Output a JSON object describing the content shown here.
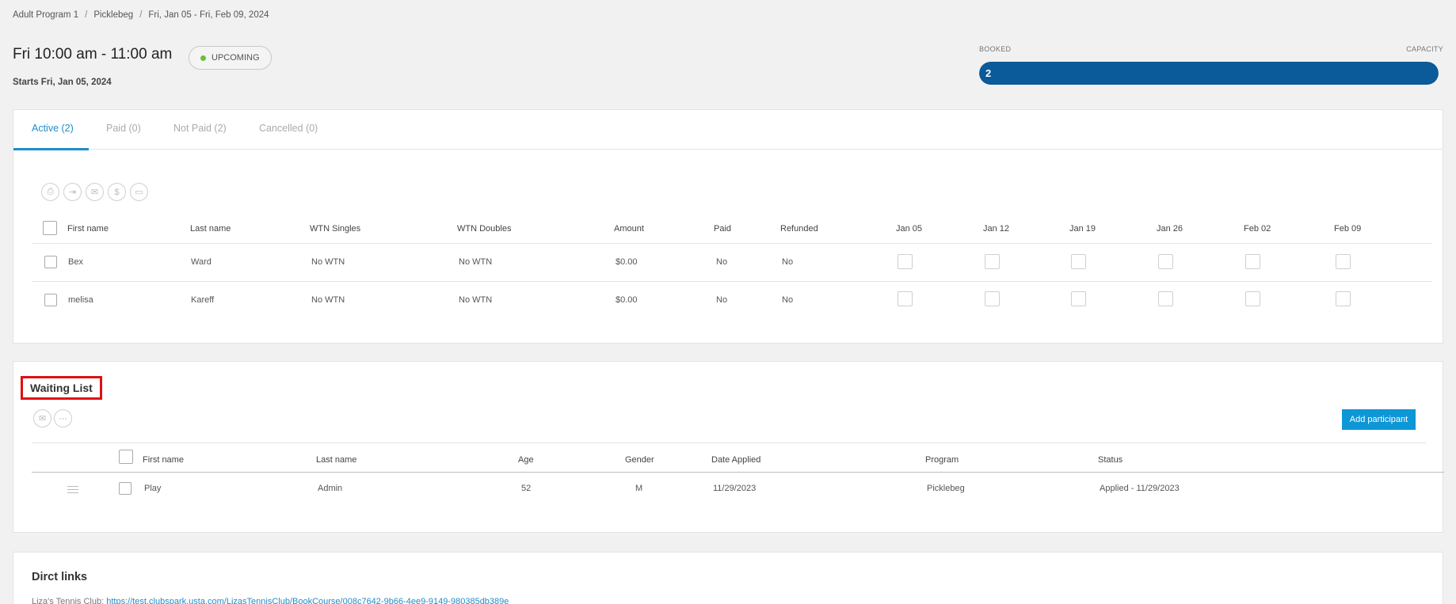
{
  "breadcrumb": [
    "Adult Program 1",
    "Picklebeg",
    "Fri, Jan 05 - Fri, Feb 09, 2024"
  ],
  "session": {
    "time": "Fri 10:00 am - 11:00 am",
    "status": "UPCOMING",
    "starts": "Starts Fri, Jan 05, 2024"
  },
  "capacity": {
    "booked_label": "BOOKED",
    "capacity_label": "CAPACITY",
    "booked": "2",
    "fill_fraction": 1.0
  },
  "tabs": [
    {
      "label": "Active (2)",
      "active": true
    },
    {
      "label": "Paid (0)",
      "active": false
    },
    {
      "label": "Not Paid (2)",
      "active": false
    },
    {
      "label": "Cancelled (0)",
      "active": false
    }
  ],
  "toolbar_icons": [
    "print-icon",
    "export-icon",
    "email-icon",
    "dollar-icon",
    "credit-card-icon"
  ],
  "participants": {
    "headers": [
      "First name",
      "Last name",
      "WTN Singles",
      "WTN Doubles",
      "Amount",
      "Paid",
      "Refunded",
      "Jan 05",
      "Jan 12",
      "Jan 19",
      "Jan 26",
      "Feb 02",
      "Feb 09"
    ],
    "rows": [
      {
        "first": "Bex",
        "last": "Ward",
        "wtn_singles": "No WTN",
        "wtn_doubles": "No WTN",
        "amount": "$0.00",
        "paid": "No",
        "refunded": "No"
      },
      {
        "first": "melisa",
        "last": "Kareff",
        "wtn_singles": "No WTN",
        "wtn_doubles": "No WTN",
        "amount": "$0.00",
        "paid": "No",
        "refunded": "No"
      }
    ]
  },
  "waiting_list": {
    "title": "Waiting List",
    "add_button": "Add participant",
    "icons": [
      "email-icon",
      "more-icon"
    ],
    "headers": [
      "First name",
      "Last name",
      "Age",
      "Gender",
      "Date Applied",
      "Program",
      "Status"
    ],
    "rows": [
      {
        "first": "Play",
        "last": "Admin",
        "age": "52",
        "gender": "M",
        "date_applied": "11/29/2023",
        "program": "Picklebeg",
        "status": "Applied - 11/29/2023"
      }
    ]
  },
  "direct_links": {
    "title": "Dirct links",
    "prefix": "Liza's Tennis Club:",
    "url": "https://test.clubspark.usta.com/LizasTennisClub/BookCourse/008c7642-9b66-4ee9-9149-980385db389e"
  },
  "colors": {
    "accent": "#1e8dc9",
    "bar": "#0b5a9a",
    "button": "#0d97d6",
    "highlight": "#e01010",
    "status_dot": "#6cbf3a"
  }
}
